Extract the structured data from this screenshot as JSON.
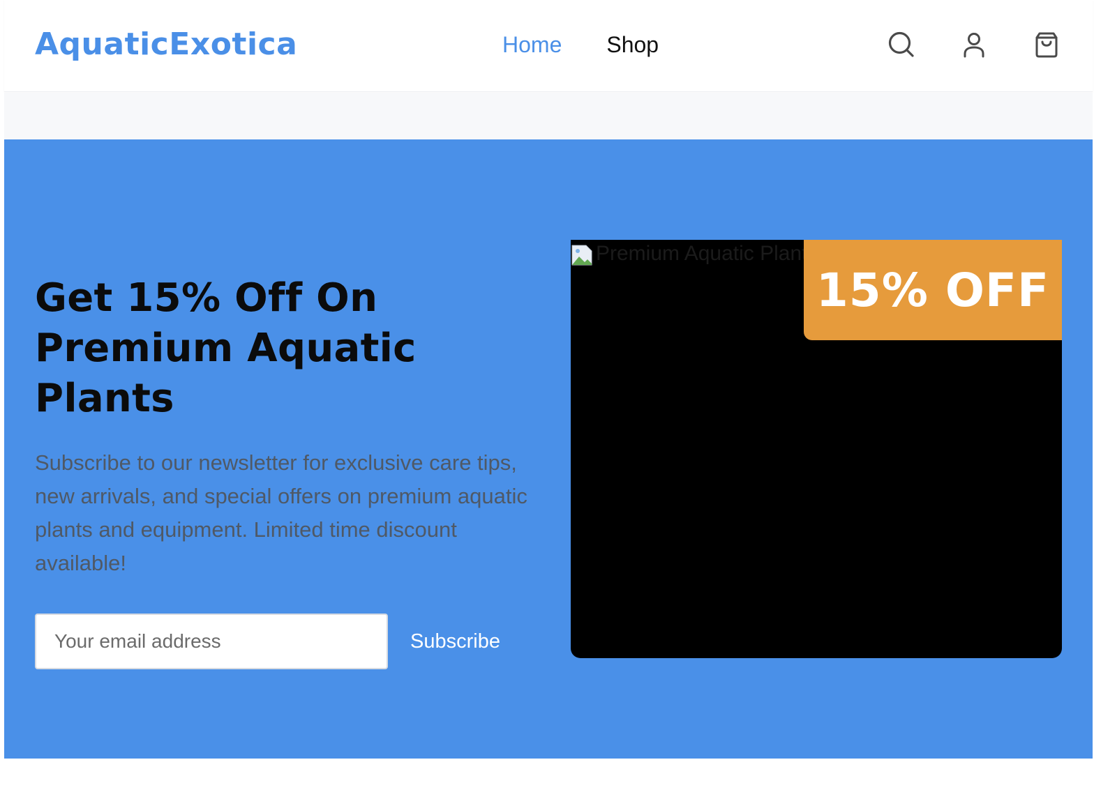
{
  "brand": {
    "name": "AquaticExotica"
  },
  "nav": {
    "items": [
      {
        "label": "Home",
        "active": true
      },
      {
        "label": "Shop",
        "active": false
      }
    ]
  },
  "header_icons": [
    "search-icon",
    "user-icon",
    "cart-icon"
  ],
  "promo": {
    "headline": "Get 15% Off On Premium Aquatic Plants",
    "description": "Subscribe to our newsletter for exclusive care tips, new arrivals, and special offers on premium aquatic plants and equipment. Limited time discount available!",
    "email_placeholder": "Your email address",
    "subscribe_label": "Subscribe",
    "image_alt": "Premium Aquatic Plants",
    "badge": "15% OFF"
  },
  "colors": {
    "brand": "#4a8fe7",
    "promo_bg": "#4a90e8",
    "nav_active": "#4a8fe7",
    "nav_inactive": "#111111",
    "description_text": "#4f5966",
    "badge_bg": "#e69b3c",
    "icon": "#4a4a4a"
  }
}
